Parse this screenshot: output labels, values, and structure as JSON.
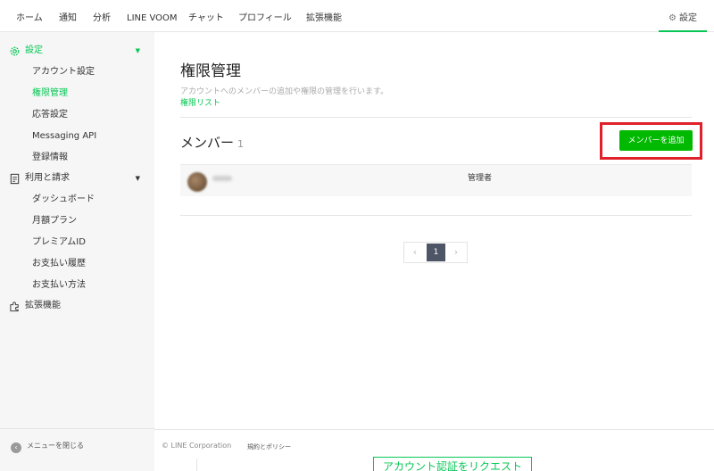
{
  "topnav": {
    "items": [
      "ホーム",
      "通知",
      "分析",
      "LINE VOOM",
      "チャット",
      "プロフィール",
      "拡張機能"
    ],
    "settings_label": "設定"
  },
  "sidebar": {
    "groups": [
      {
        "label": "設定",
        "icon": "gear-icon",
        "children": [
          "アカウント設定",
          "権限管理",
          "応答設定",
          "Messaging API",
          "登録情報"
        ]
      },
      {
        "label": "利用と請求",
        "icon": "receipt-icon",
        "children": [
          "ダッシュボード",
          "月額プラン",
          "プレミアムID",
          "お支払い履歴",
          "お支払い方法"
        ]
      },
      {
        "label": "拡張機能",
        "icon": "puzzle-icon",
        "children": []
      }
    ],
    "close_menu_label": "メニューを閉じる"
  },
  "main": {
    "title": "権限管理",
    "description": "アカウントへのメンバーの追加や権限の管理を行います。",
    "permission_list_link": "権限リスト",
    "members_title": "メンバー",
    "members_count": "1",
    "add_member_label": "メンバーを追加",
    "members": [
      {
        "name": "小林",
        "role": "管理者"
      }
    ],
    "pagination": {
      "current": "1",
      "prev": "‹",
      "next": "›"
    }
  },
  "footer": {
    "copyright": "© LINE Corporation",
    "terms": "規約とポリシー",
    "verify_button": "アカウント認証をリクエスト"
  },
  "colors": {
    "accent": "#06c755",
    "button": "#00b900",
    "highlight": "#e0202a"
  }
}
